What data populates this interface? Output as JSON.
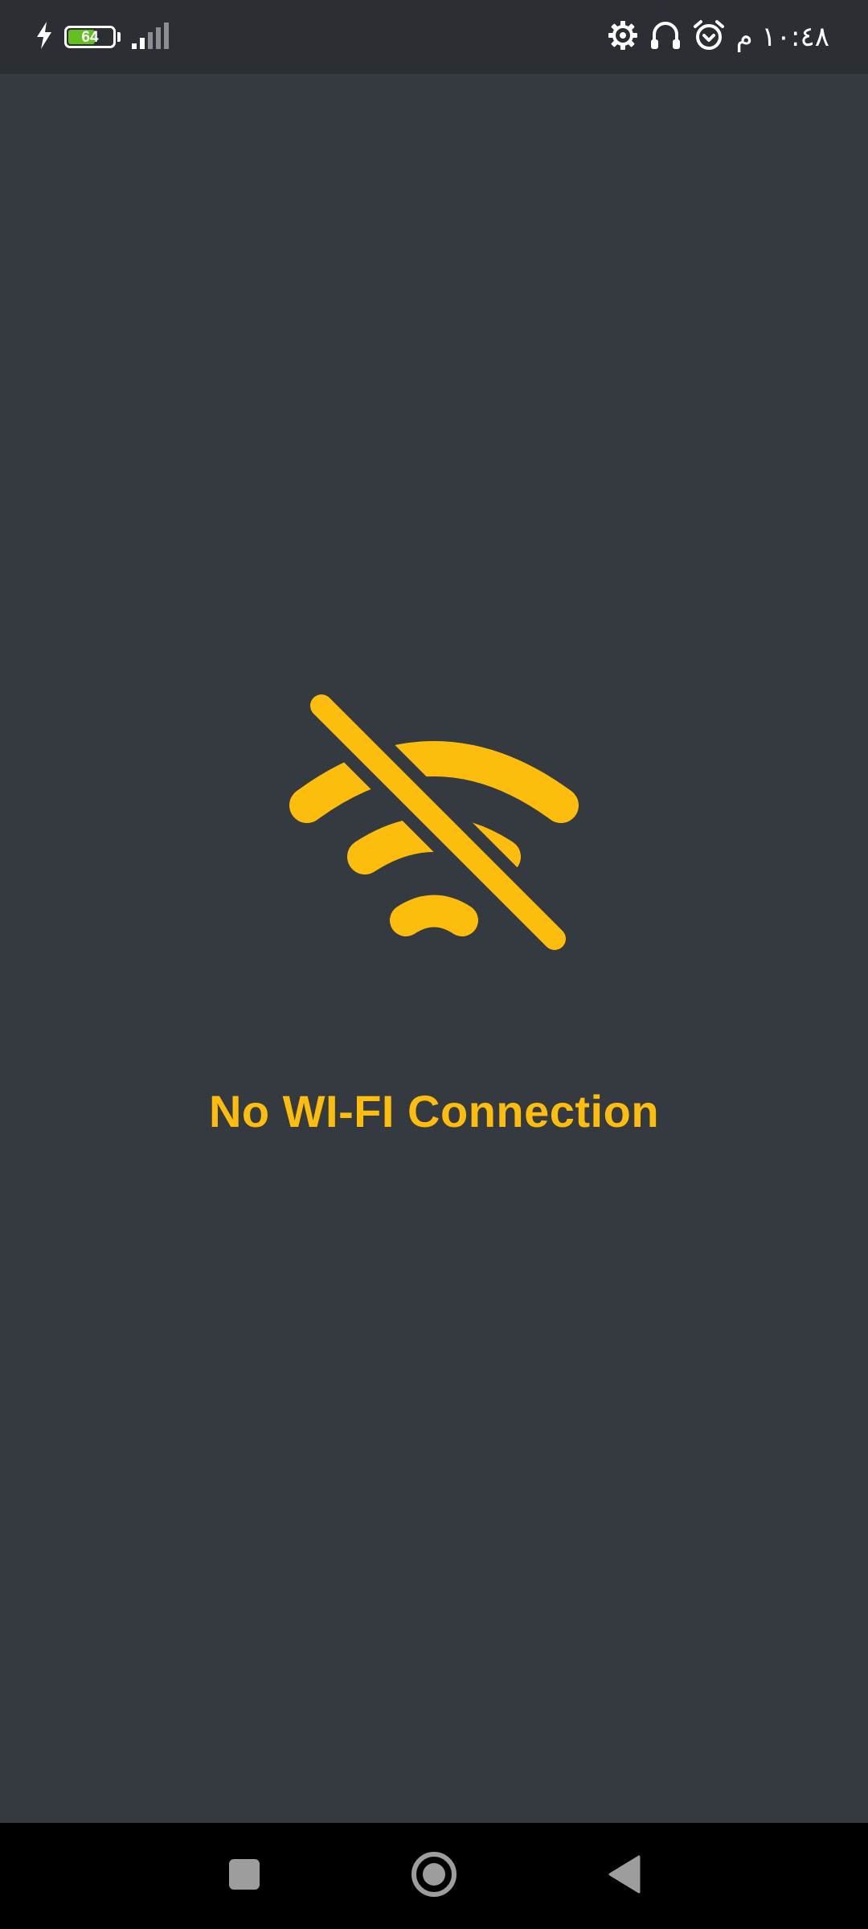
{
  "status_bar": {
    "battery_level": "64",
    "battery_fraction": 0.64,
    "clock": "١٠:٤٨ م",
    "icons": [
      "charging-bolt-icon",
      "battery-icon",
      "signal-icon",
      "settings-gear-icon",
      "headphones-icon",
      "alarm-icon"
    ]
  },
  "main": {
    "icon": "wifi-off-icon",
    "message": "No WI-FI Connection"
  },
  "nav_bar": {
    "buttons": [
      "recents-button",
      "home-button",
      "back-button"
    ]
  },
  "colors": {
    "background": "#353940",
    "status_bar": "#2b2e33",
    "accent": "#fdbd0c",
    "battery_fill": "#63c01f",
    "nav_bar": "#000000"
  }
}
